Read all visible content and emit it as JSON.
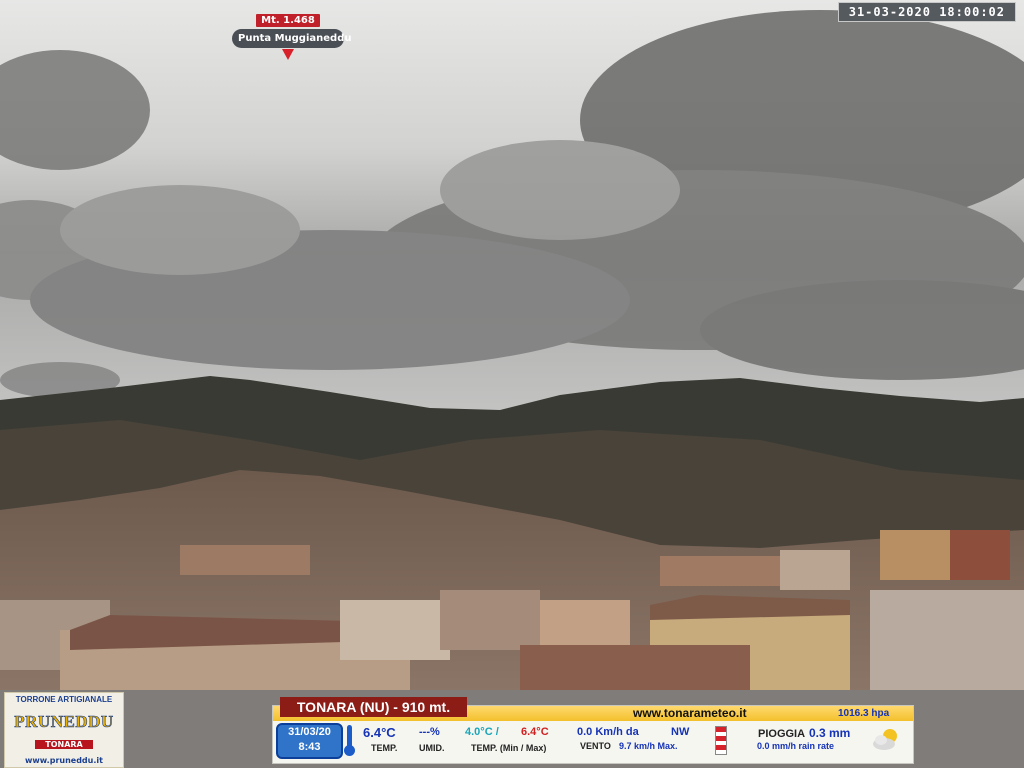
{
  "timestamp": "31-03-2020  18:00:02",
  "peak_marker": {
    "altitude": "Mt. 1.468",
    "name": "Punta Muggianeddu"
  },
  "sponsor": {
    "line1": "TORRONE ARTIGIANALE",
    "brand": "PRUNEDDU",
    "town": "TONARA",
    "website": "www.pruneddu.it"
  },
  "weather": {
    "location": "TONARA (NU) - 910 mt.",
    "website": "www.tonarameteo.it",
    "pressure": "1016.3  hpa",
    "date": "31/03/20",
    "time": "8:43",
    "temp": "6.4°C",
    "temp_label": "TEMP.",
    "humidity": "---%",
    "humidity_label": "UMID.",
    "temp_min": "4.0°C /",
    "temp_max": "6.4°C",
    "minmax_label": "TEMP. (Min / Max)",
    "wind": "0.0 Km/h da",
    "wind_dir": "NW",
    "gust_label": "VENTO",
    "gust_value": "9.7 km/h Max.",
    "rain_label": "PIOGGIA",
    "rain_value": "0.3 mm",
    "rain_rate": "0.0 mm/h rain rate"
  },
  "colors": {
    "title_bg": "#8c1d16",
    "accent_blue": "#1533b5",
    "min_color": "#1aa5b8",
    "max_color": "#d01f1f",
    "header_bar": "#f3c02c"
  },
  "icons": [
    "thermometer-icon",
    "wind-sock-icon",
    "cloud-sun-icon",
    "location-pin-icon"
  ]
}
